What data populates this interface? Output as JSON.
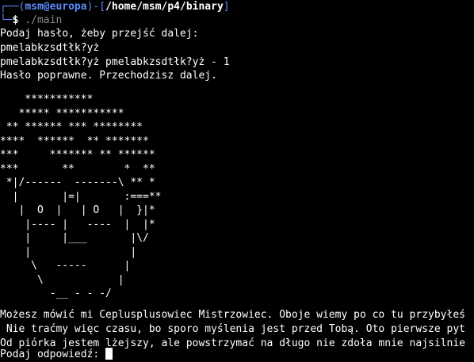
{
  "prompt": {
    "frame_top": "┌──(",
    "user_host": "msm@europa",
    "frame_mid": ")-[",
    "path": "/home/msm/p4/binary",
    "frame_end": "]",
    "frame_bottom": "└─",
    "dollar": "$",
    "command": "./main"
  },
  "output": {
    "line1": "Podaj hasło, żeby przejść dalej:",
    "line2": "pmelabkzsdtłk?yż",
    "line3": "pmelabkzsdtłk?yż pmelabkzsdtłk?yż - 1",
    "line4": "Hasło poprawne. Przechodzisz dalej."
  },
  "ascii_art": "    ***********\n   ***** ***********\n ** ****** *** ********\n****  ******  ** *******\n***     ******* ** ******\n***       **        *  **\n *|/------  -------\\ ** *\n  |       |=|       :===**\n   |  O  |   | O   |  }|*\n    |---- |   ----  |  |*\n    |     |___       |\\/\n    |                |\n     \\   -----      |\n      \\            |\n        -__ - - -/",
  "message": {
    "line1": "Możesz mówić mi Ceplusplusowiec Mistrzowiec. Oboje wiemy po co tu przybyłeś",
    "line2": " Nie traćmy więc czasu, bo sporo myślenia jest przed Tobą. Oto pierwsze pyt",
    "line3": "Od piórka jestem lżejszy, ale powstrzymać na długo nie zdoła mnie najsilnie",
    "answer_prompt": "Podaj odpowiedź: "
  }
}
